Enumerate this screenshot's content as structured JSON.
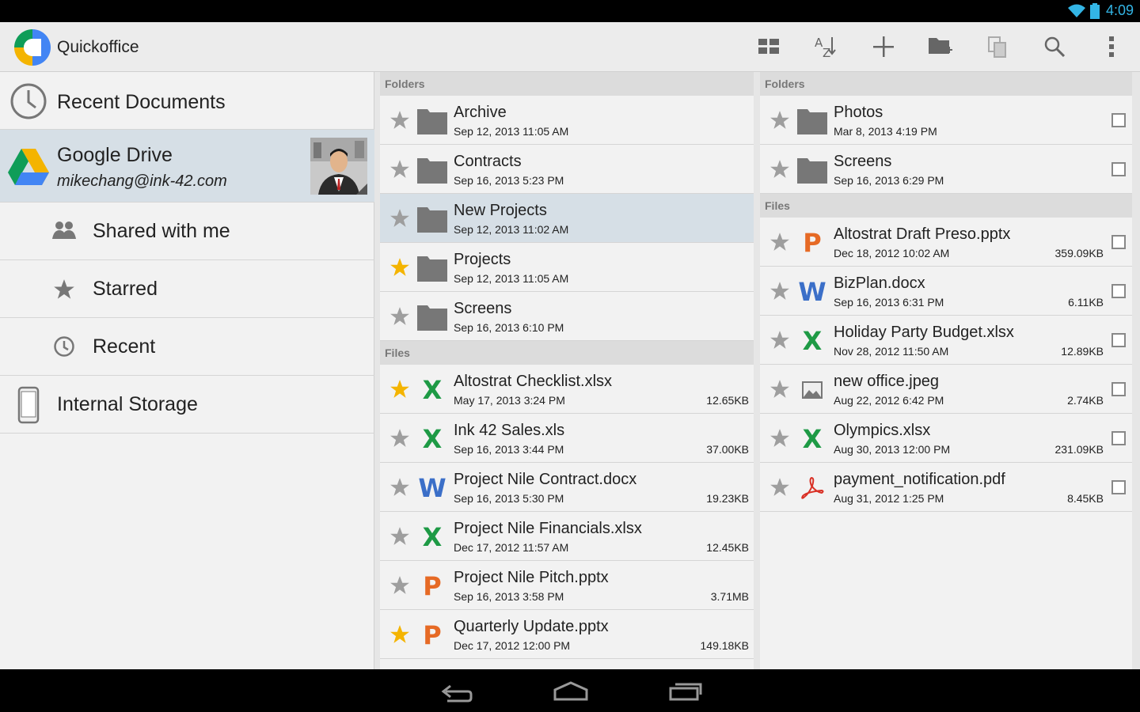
{
  "status": {
    "time": "4:09"
  },
  "app": {
    "title": "Quickoffice"
  },
  "toolbar": {
    "icons": [
      "view-toggle-icon",
      "sort-az-icon",
      "add-icon",
      "new-folder-icon",
      "copy-icon",
      "search-icon",
      "overflow-menu-icon"
    ]
  },
  "nav": {
    "recent_documents": "Recent Documents",
    "drive": {
      "title": "Google Drive",
      "email": "mikechang@ink-42.com"
    },
    "shared": "Shared with me",
    "starred": "Starred",
    "recent": "Recent",
    "internal": "Internal Storage"
  },
  "mid": {
    "folders_header": "Folders",
    "folders": [
      {
        "name": "Archive",
        "date": "Sep 12, 2013 11:05 AM",
        "starred": false
      },
      {
        "name": "Contracts",
        "date": "Sep 16, 2013 5:23 PM",
        "starred": false
      },
      {
        "name": "New Projects",
        "date": "Sep 12, 2013 11:02 AM",
        "starred": false,
        "selected": true
      },
      {
        "name": "Projects",
        "date": "Sep 12, 2013 11:05 AM",
        "starred": true
      },
      {
        "name": "Screens",
        "date": "Sep 16, 2013 6:10 PM",
        "starred": false
      }
    ],
    "files_header": "Files",
    "files": [
      {
        "name": "Altostrat Checklist.xlsx",
        "date": "May 17, 2013 3:24 PM",
        "size": "12.65KB",
        "type": "xlsx",
        "starred": true
      },
      {
        "name": "Ink 42 Sales.xls",
        "date": "Sep 16, 2013 3:44 PM",
        "size": "37.00KB",
        "type": "xlsx",
        "starred": false
      },
      {
        "name": "Project Nile Contract.docx",
        "date": "Sep 16, 2013 5:30 PM",
        "size": "19.23KB",
        "type": "docx",
        "starred": false
      },
      {
        "name": "Project Nile Financials.xlsx",
        "date": "Dec 17, 2012 11:57 AM",
        "size": "12.45KB",
        "type": "xlsx",
        "starred": false
      },
      {
        "name": "Project Nile Pitch.pptx",
        "date": "Sep 16, 2013 3:58 PM",
        "size": "3.71MB",
        "type": "pptx",
        "starred": false
      },
      {
        "name": "Quarterly Update.pptx",
        "date": "Dec 17, 2012 12:00 PM",
        "size": "149.18KB",
        "type": "pptx",
        "starred": true
      }
    ]
  },
  "right": {
    "folders_header": "Folders",
    "folders": [
      {
        "name": "Photos",
        "date": "Mar 8, 2013 4:19 PM",
        "starred": false
      },
      {
        "name": "Screens",
        "date": "Sep 16, 2013 6:29 PM",
        "starred": false
      }
    ],
    "files_header": "Files",
    "files": [
      {
        "name": "Altostrat Draft Preso.pptx",
        "date": "Dec 18, 2012 10:02 AM",
        "size": "359.09KB",
        "type": "pptx",
        "starred": false
      },
      {
        "name": "BizPlan.docx",
        "date": "Sep 16, 2013 6:31 PM",
        "size": "6.11KB",
        "type": "docx",
        "starred": false
      },
      {
        "name": "Holiday Party Budget.xlsx",
        "date": "Nov 28, 2012 11:50 AM",
        "size": "12.89KB",
        "type": "xlsx",
        "starred": false
      },
      {
        "name": "new office.jpeg",
        "date": "Aug 22, 2012 6:42 PM",
        "size": "2.74KB",
        "type": "image",
        "starred": false
      },
      {
        "name": "Olympics.xlsx",
        "date": "Aug 30, 2013 12:00 PM",
        "size": "231.09KB",
        "type": "xlsx",
        "starred": false
      },
      {
        "name": "payment_notification.pdf",
        "date": "Aug 31, 2012 1:25 PM",
        "size": "8.45KB",
        "type": "pdf",
        "starred": false
      }
    ]
  },
  "colors": {
    "accent": "#33b5e5",
    "selected": "#d6dfe6",
    "star_on": "#f4b400",
    "star_off": "#9e9e9e",
    "xlsx": "#1e9a45",
    "docx": "#3b6fc8",
    "pptx": "#e66a25",
    "pdf": "#d93025"
  }
}
